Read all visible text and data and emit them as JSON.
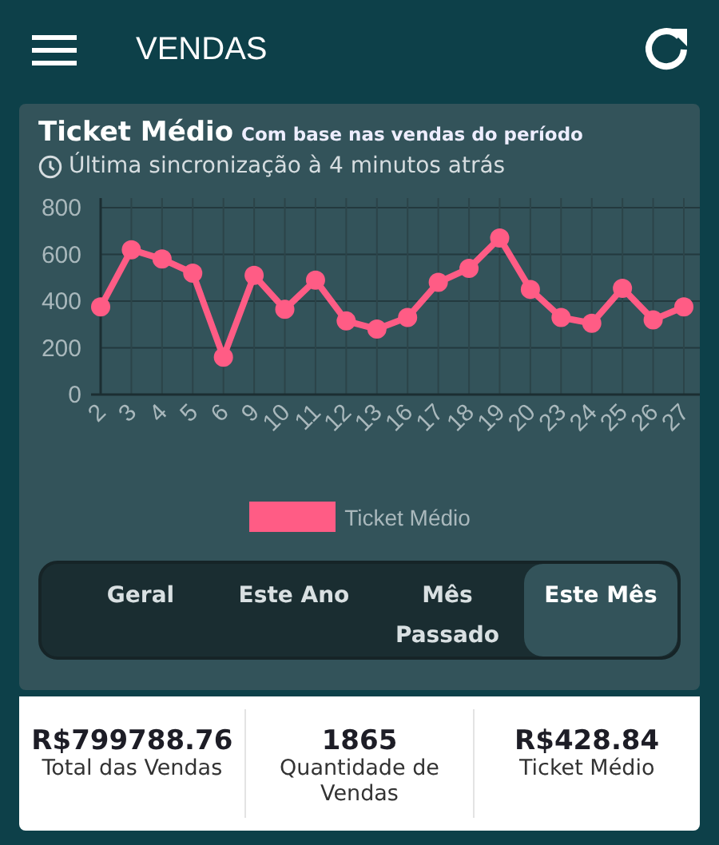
{
  "header": {
    "title": "VENDAS"
  },
  "card": {
    "title": "Ticket Médio",
    "subtitle": "Com base nas vendas do período",
    "sync": "Última sincronização à 4 minutos atrás"
  },
  "chart_data": {
    "type": "line",
    "categories": [
      "2",
      "3",
      "4",
      "5",
      "6",
      "9",
      "10",
      "11",
      "12",
      "13",
      "16",
      "17",
      "18",
      "19",
      "20",
      "23",
      "24",
      "25",
      "26",
      "27"
    ],
    "grid": true,
    "series": [
      {
        "name": "Ticket Médio",
        "color": "#ff5c85",
        "marker": true,
        "values": [
          375,
          620,
          580,
          520,
          160,
          510,
          365,
          490,
          315,
          280,
          330,
          480,
          540,
          670,
          450,
          330,
          305,
          455,
          320,
          375
        ]
      }
    ],
    "ylim": [
      0,
      800
    ],
    "yticks": [
      0,
      200,
      400,
      600,
      800
    ]
  },
  "periods": [
    {
      "label": "Geral",
      "selected": false
    },
    {
      "label": "Este Ano",
      "selected": false
    },
    {
      "label": "Mês Passado",
      "selected": false
    },
    {
      "label": "Este Mês",
      "selected": true
    }
  ],
  "stats": [
    {
      "value": "R$799788.76",
      "label": "Total das Vendas"
    },
    {
      "value": "1865",
      "label": "Quantidade de Vendas"
    },
    {
      "value": "R$428.84",
      "label": "Ticket Médio"
    }
  ]
}
